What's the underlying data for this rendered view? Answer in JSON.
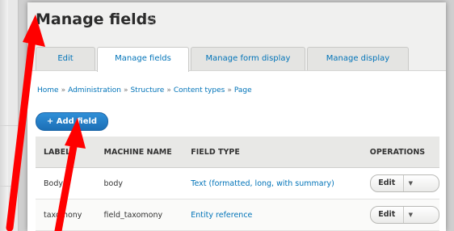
{
  "page": {
    "title": "Manage fields",
    "tabs": [
      {
        "label": "Edit",
        "active": false
      },
      {
        "label": "Manage fields",
        "active": true
      },
      {
        "label": "Manage form display",
        "active": false
      },
      {
        "label": "Manage display",
        "active": false
      }
    ],
    "breadcrumb": [
      "Home",
      "Administration",
      "Structure",
      "Content types",
      "Page"
    ],
    "add_field_label": "+ Add field"
  },
  "table": {
    "headers": [
      "LABEL",
      "MACHINE NAME",
      "FIELD TYPE",
      "OPERATIONS"
    ],
    "rows": [
      {
        "label": "Body",
        "machine_name": "body",
        "field_type": "Text (formatted, long, with summary)",
        "op": "Edit"
      },
      {
        "label": "taxomony",
        "machine_name": "field_taxomony",
        "field_type": "Entity reference",
        "op": "Edit"
      }
    ]
  },
  "colors": {
    "link": "#0073b8",
    "button": "#1c6fb6",
    "arrow": "#ff0000"
  },
  "icons": {
    "favorite": "star-icon",
    "dropdown": "chevron-down-icon",
    "annotation": "red-arrow"
  }
}
